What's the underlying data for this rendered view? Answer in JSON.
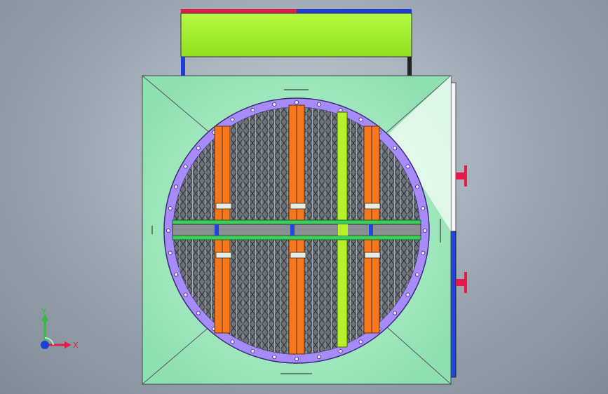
{
  "viewport": {
    "background_top": "#c9d1d9",
    "background_bottom": "#7f8a96"
  },
  "model": {
    "housing_color": "#aef0c8",
    "flange_color": "#a78bfa",
    "top_box_color": "#a6f43a",
    "top_rail_left_color": "#e11d48",
    "top_rail_right_color": "#1e3fd6",
    "side_panel_color": "#2346d8",
    "bar_orange": "#f5781e",
    "bar_lime": "#b8f02a",
    "crossbar_green": "#3ccf5a",
    "grid_dark": "#4a4f55",
    "grid_light": "#9aa0a6"
  },
  "triad": {
    "x_label": "X",
    "y_label": "Y",
    "x_icon": "x-axis-arrow-icon",
    "y_icon": "y-axis-arrow-icon",
    "z_icon": "z-axis-dot-icon"
  }
}
